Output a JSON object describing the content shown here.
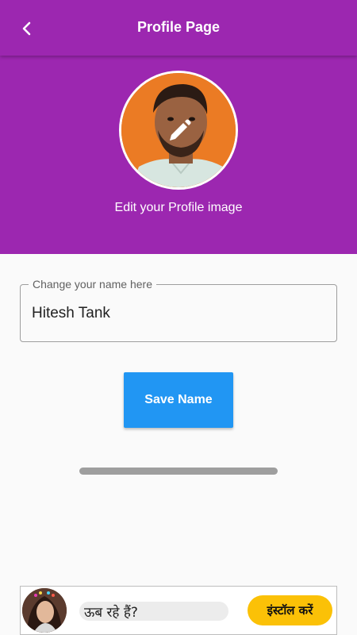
{
  "colors": {
    "app_bar": "#9c27b0",
    "header_band": "#9c27b0",
    "save_button": "#2196f3",
    "install_button": "#fbc107",
    "progress_bar": "#9e9e9e"
  },
  "app_bar": {
    "back_icon": "chevron-left-icon",
    "title": "Profile Page"
  },
  "profile": {
    "image_alt": "profile-photo",
    "edit_icon": "pencil-icon",
    "edit_caption": "Edit your Profile image"
  },
  "name_field": {
    "label": "Change your name here",
    "value": "Hitesh Tank"
  },
  "save_button": {
    "label": "Save Name"
  },
  "ad_banner": {
    "text": "ऊब रहे हैं?",
    "install_label": "इंस्टॉल करें"
  }
}
